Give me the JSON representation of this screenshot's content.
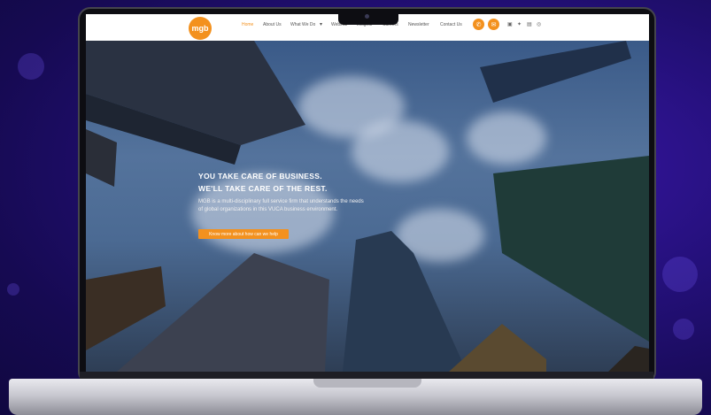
{
  "site": {
    "logo_text": "mgb",
    "nav": [
      "Home",
      "About Us",
      "What We Do",
      "Webinar",
      "Insights",
      "Careers",
      "Newsletter",
      "Contact Us"
    ],
    "nav_dropdown_icon": "chevron-down-icon",
    "action_icons": [
      "phone-icon",
      "email-icon"
    ],
    "social_icons": [
      "linkedin-icon",
      "twitter-icon",
      "facebook-icon",
      "instagram-icon"
    ]
  },
  "hero": {
    "title_line1": "YOU TAKE CARE OF BUSINESS.",
    "title_line2": "WE'LL TAKE CARE OF THE REST.",
    "description": "MGB is a multi-disciplinary full service firm that understands the needs of global organizations in this VUCA business environment.",
    "cta_label": "Know more about how can we help"
  },
  "colors": {
    "accent": "#f3911e",
    "background": "#1c0c66"
  }
}
